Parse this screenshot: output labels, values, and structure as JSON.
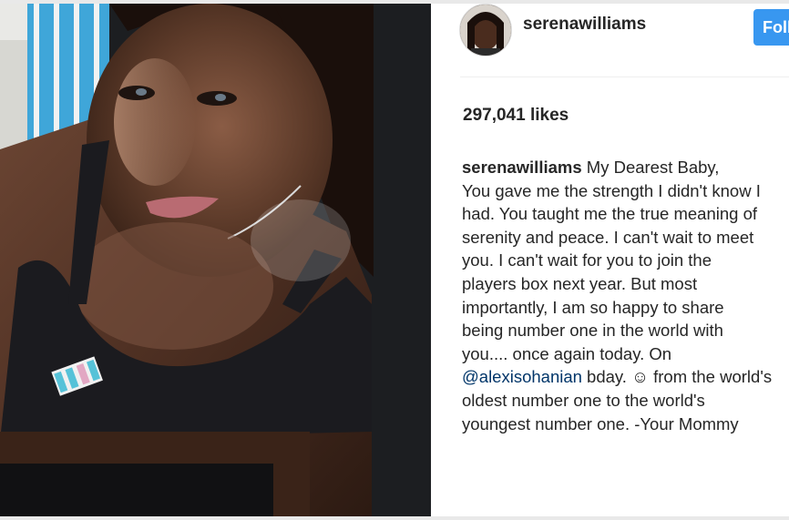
{
  "post": {
    "username": "serenawilliams",
    "follow_label": "Follow",
    "likes": "297,041 likes",
    "caption": {
      "author": "serenawilliams",
      "lines": [
        "My Dearest Baby,",
        "You gave me the strength I didn't know I",
        "had. You taught me the true meaning of",
        "serenity and peace. I can't wait to meet",
        "you. I can't wait for you to join the",
        "players box next year. But most",
        "importantly, I am so happy to share",
        "being number one in the world with",
        "you.... once again today. On"
      ],
      "mention": "@alexisohanian",
      "line_after_mention": " bday. ☺ from the world's",
      "lines_end": [
        "oldest number one to the world's",
        "youngest number one. -Your Mommy"
      ]
    }
  },
  "colors": {
    "accent": "#3897f0",
    "mention": "#003569",
    "text": "#262626"
  },
  "icons": {
    "avatar": "profile-photo",
    "emoji": "smiling-face"
  }
}
